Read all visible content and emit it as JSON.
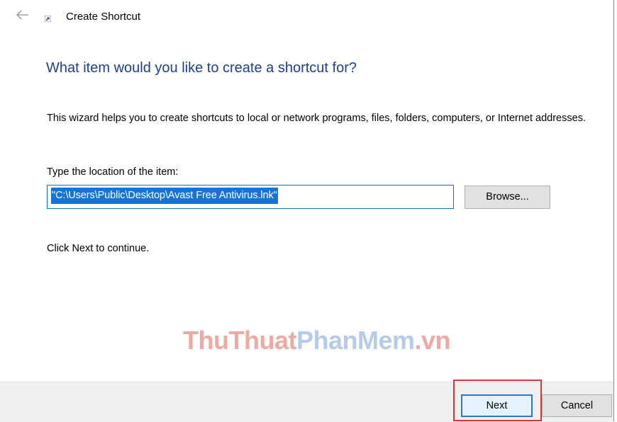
{
  "window": {
    "title": "Create Shortcut",
    "back_icon": "left-arrow-icon",
    "app_icon": "shortcut-icon"
  },
  "page": {
    "heading": "What item would you like to create a shortcut for?",
    "description": "This wizard helps you to create shortcuts to local or network programs, files, folders, computers, or Internet addresses.",
    "location_label": "Type the location of the item:",
    "location_value": "\"C:\\Users\\Public\\Desktop\\Avast Free Antivirus.lnk\"",
    "browse_label": "Browse...",
    "continue_text": "Click Next to continue."
  },
  "footer": {
    "next_label": "Next",
    "cancel_label": "Cancel"
  },
  "watermark": {
    "part1": "ThuThuat",
    "part2": "PhanMem",
    "part3": ".vn"
  },
  "colors": {
    "heading": "#1e3e8a",
    "selection": "#1874d4",
    "highlight": "#cc3b3b",
    "footer_bg": "#f0f0f0"
  }
}
